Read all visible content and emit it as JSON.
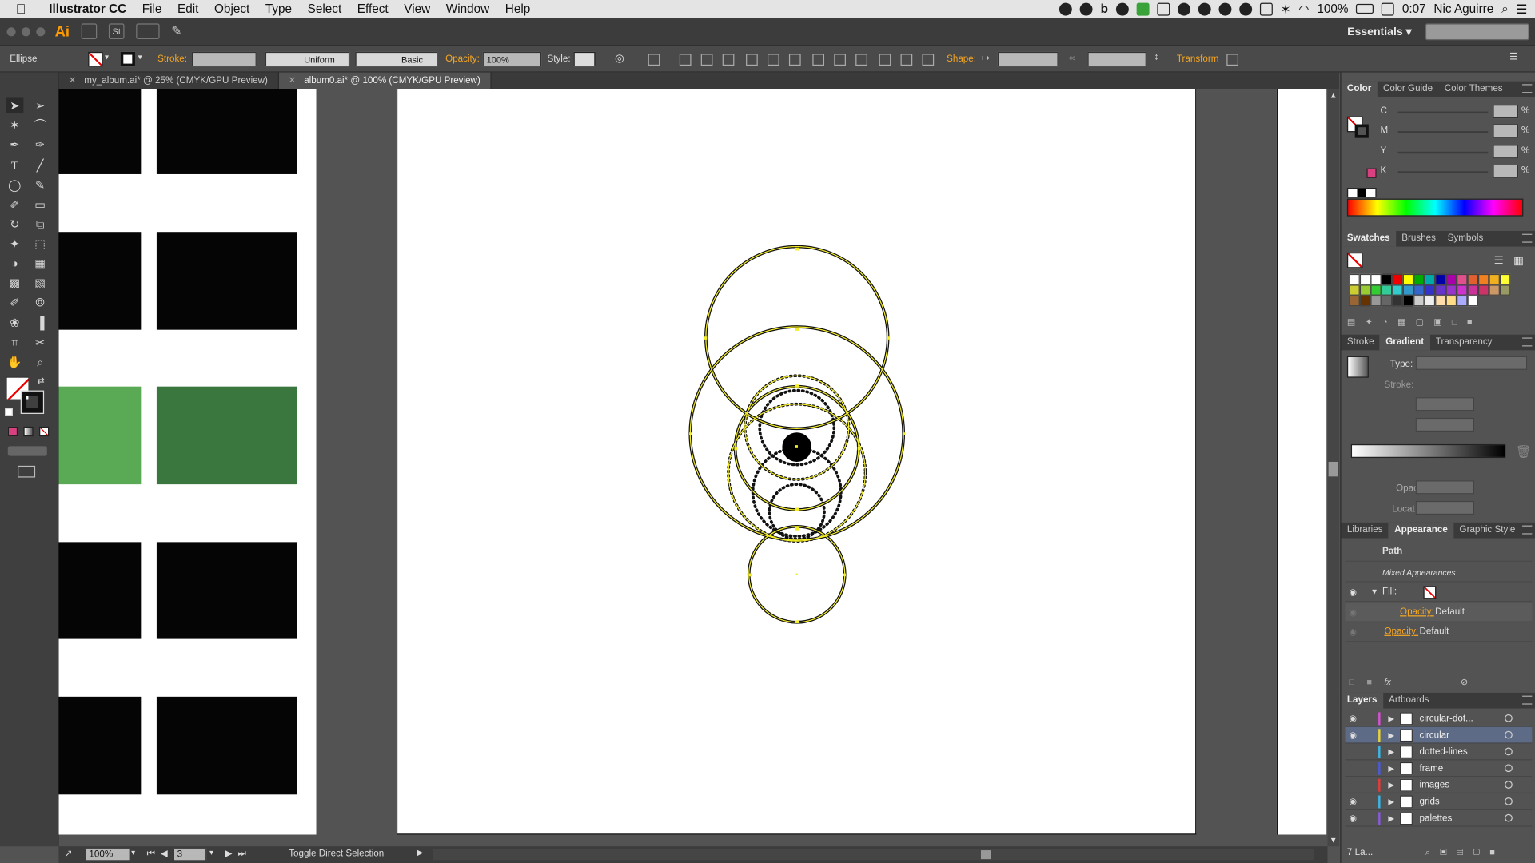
{
  "menubar": {
    "app_name": "Illustrator CC",
    "items": [
      "File",
      "Edit",
      "Object",
      "Type",
      "Select",
      "Effect",
      "View",
      "Window",
      "Help"
    ],
    "battery": "100%",
    "time": "0:07",
    "user": "Nic Aguirre"
  },
  "appbar": {
    "logo": "Ai",
    "st_label": "St",
    "workspace": "Essentials"
  },
  "control": {
    "selection": "Ellipse",
    "stroke_label": "Stroke:",
    "profile": "Uniform",
    "brush": "Basic",
    "opacity_label": "Opacity:",
    "opacity_value": "100%",
    "style_label": "Style:",
    "shape_label": "Shape:",
    "transform_label": "Transform"
  },
  "tabs": [
    {
      "label": "my_album.ai* @ 25% (CMYK/GPU Preview)",
      "active": false
    },
    {
      "label": "album0.ai* @ 100% (CMYK/GPU Preview)",
      "active": true
    }
  ],
  "status": {
    "zoom": "100%",
    "artboard": "3",
    "tool_hint": "Toggle Direct Selection"
  },
  "panels": {
    "color": {
      "tabs": [
        "Color",
        "Color Guide",
        "Color Themes"
      ],
      "channels": [
        "C",
        "M",
        "Y",
        "K"
      ],
      "percent": "%"
    },
    "swatches": {
      "tabs": [
        "Swatches",
        "Brushes",
        "Symbols"
      ]
    },
    "gradient": {
      "tabs": [
        "Stroke",
        "Gradient",
        "Transparency"
      ],
      "type_label": "Type:",
      "stroke_label": "Stroke:",
      "opacity_label": "Opacity:",
      "location_label": "Location:"
    },
    "appearance": {
      "tabs": [
        "Libraries",
        "Appearance",
        "Graphic Style"
      ],
      "path": "Path",
      "mixed": "Mixed Appearances",
      "fill_label": "Fill:",
      "opacity_label": "Opacity:",
      "opacity_value": "Default",
      "opacity2_label": "Opacity:",
      "opacity2_value": "Default"
    },
    "layers": {
      "tabs": [
        "Layers",
        "Artboards"
      ],
      "rows": [
        {
          "name": "circular-dot...",
          "color": "#d94fd9",
          "visible": true
        },
        {
          "name": "circular",
          "color": "#e8d23a",
          "visible": true
        },
        {
          "name": "dotted-lines",
          "color": "#3ab8e8",
          "visible": false
        },
        {
          "name": "frame",
          "color": "#4a5ad9",
          "visible": false
        },
        {
          "name": "images",
          "color": "#e83a3a",
          "visible": false
        },
        {
          "name": "grids",
          "color": "#3ab8e8",
          "visible": true
        },
        {
          "name": "palettes",
          "color": "#8a5ad9",
          "visible": true
        }
      ],
      "count": "7 La..."
    }
  }
}
